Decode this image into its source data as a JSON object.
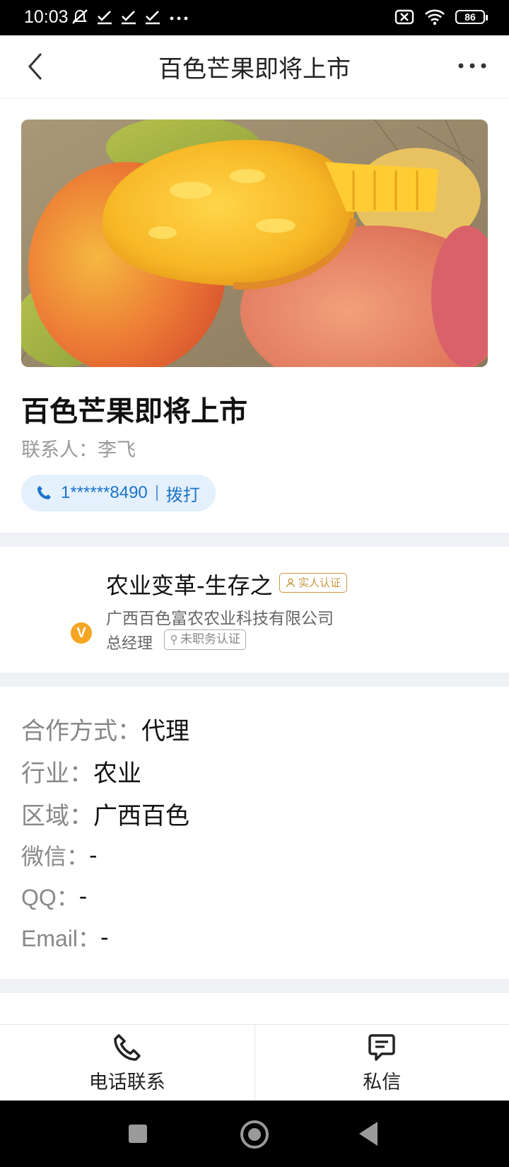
{
  "status_bar": {
    "time": "10:03",
    "battery": "86",
    "left_icons": [
      "mute-icon",
      "check-icon",
      "check-icon",
      "check-icon",
      "more-dots-icon"
    ],
    "right_icons": [
      "sim-off-icon",
      "wifi-icon",
      "battery-icon"
    ]
  },
  "navbar": {
    "title": "百色芒果即将上市"
  },
  "post": {
    "title": "百色芒果即将上市",
    "contact_label": "联系人：",
    "contact_name": "李飞",
    "phone_masked": "1******8490",
    "dial_label": "拨打"
  },
  "profile": {
    "name": "农业变革-生存之",
    "real_badge": "实人认证",
    "company": "广西百色富农农业科技有限公司",
    "role": "总经理",
    "job_badge": "未职务认证",
    "v_badge": "V"
  },
  "details": [
    {
      "key": "合作方式：",
      "value": "代理"
    },
    {
      "key": "行业：",
      "value": "农业"
    },
    {
      "key": "区域：",
      "value": "广西百色"
    },
    {
      "key": "微信：",
      "value": "-"
    },
    {
      "key": "QQ：",
      "value": "-"
    },
    {
      "key": "Email：",
      "value": "-"
    }
  ],
  "actions": {
    "call_label": "电话联系",
    "message_label": "私信"
  },
  "colors": {
    "accent_blue": "#1b74c9",
    "pill_bg": "#e4f0fb",
    "badge_gold": "#c9963c",
    "v_badge": "#f5a623",
    "separator": "#f0f1f5"
  }
}
